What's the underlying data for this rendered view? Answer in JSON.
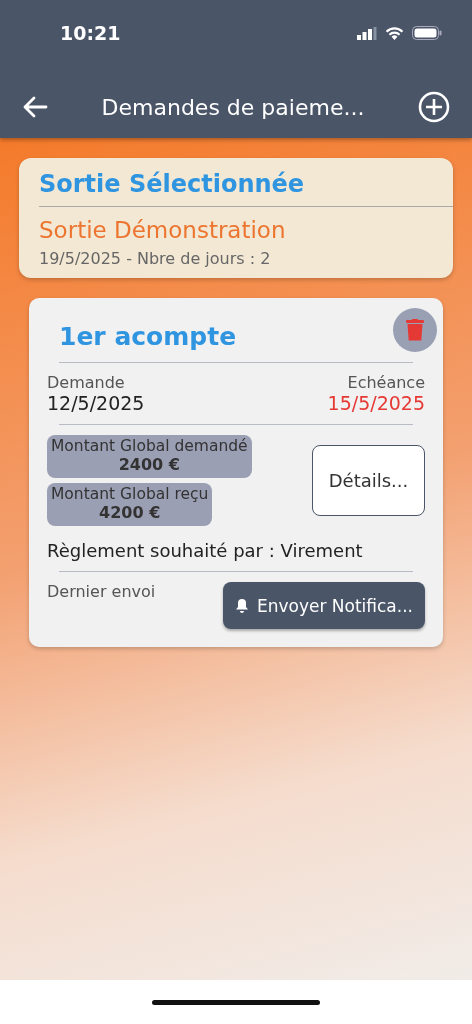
{
  "status_bar": {
    "time": "10:21"
  },
  "header": {
    "title": "Demandes de paieme..."
  },
  "selected_trip": {
    "heading": "Sortie Sélectionnée",
    "name": "Sortie Démonstration",
    "details": "19/5/2025 - Nbre de jours : 2"
  },
  "payment_requests": [
    {
      "title": "1er acompte",
      "request_label": "Demande",
      "request_date": "12/5/2025",
      "due_label": "Echéance",
      "due_date": "15/5/2025",
      "amounts": [
        {
          "label": "Montant Global demandé",
          "value": "2400 €"
        },
        {
          "label": "Montant Global reçu",
          "value": "4200 €"
        }
      ],
      "details_button": "Détails...",
      "payment_method": "Règlement souhaité par : Virement",
      "last_sent_label": "Dernier envoi",
      "notify_button": "Envoyer Notifica..."
    }
  ]
}
